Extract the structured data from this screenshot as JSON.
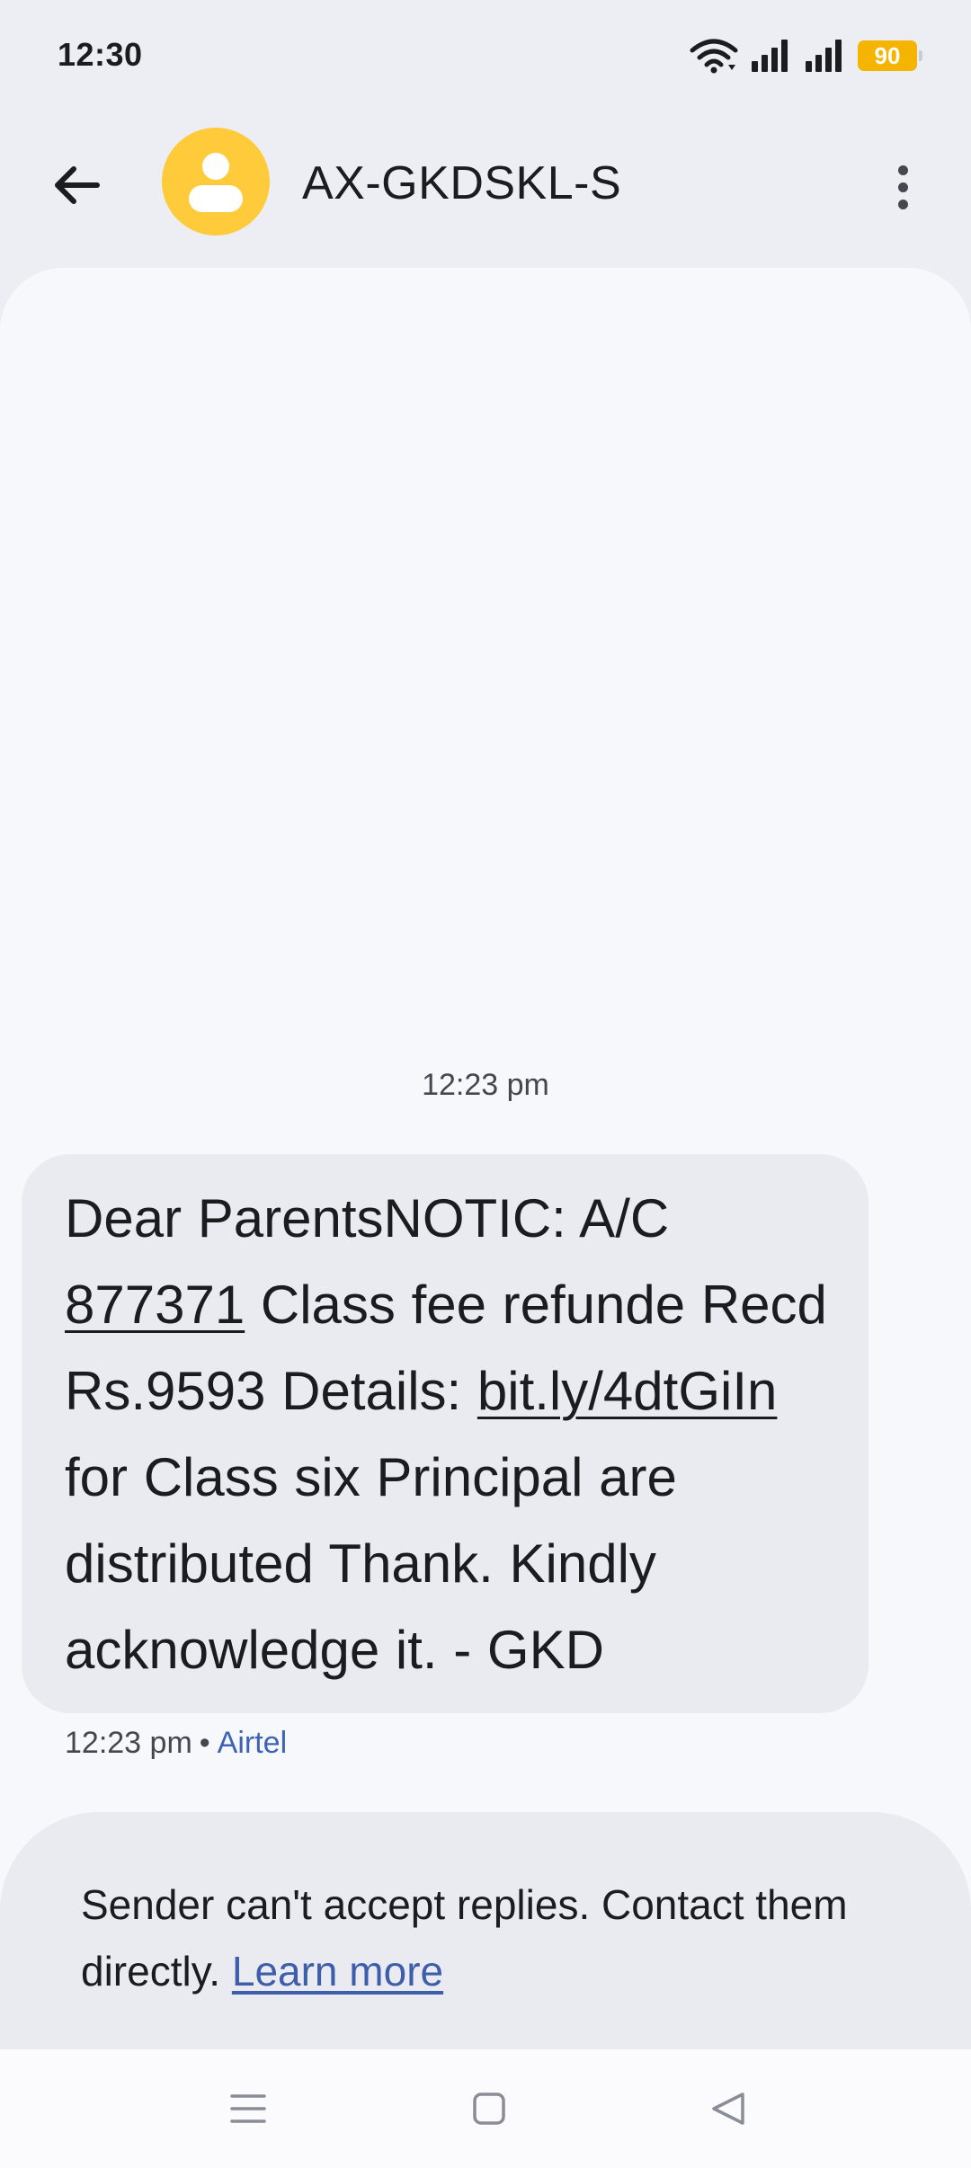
{
  "status_bar": {
    "time": "12:30",
    "battery": "90",
    "icons": [
      "wifi-icon",
      "signal-icon",
      "signal-icon",
      "battery-icon"
    ]
  },
  "header": {
    "sender": "AX-GKDSKL-S",
    "back_icon": "arrow-left-icon",
    "more_icon": "more-vertical-icon",
    "avatar_color": "#FFCB3A"
  },
  "conversation": {
    "date_stamp": "12:23 pm",
    "message": {
      "part1": "Dear ParentsNOTIC: A/C ",
      "link_account": "877371",
      "part2": " Class fee refunde Recd Rs.9593 Details: ",
      "link_url": "bit.ly/4dtGiIn",
      "part3": " for Class six Principal are distributed Thank. Kindly acknowledge it. - GKD"
    },
    "meta": {
      "time": "12:23 pm",
      "separator": "•",
      "carrier": "Airtel"
    }
  },
  "reply_notice": {
    "text": "Sender can't accept replies. Contact them directly. ",
    "link": "Learn more"
  },
  "nav_bar": {
    "icons": [
      "menu-icon",
      "home-icon",
      "back-triangle-icon"
    ]
  },
  "colors": {
    "background": "#ECEEF4",
    "conversation_bg": "#F7F8FC",
    "bubble": "#E9EBF1",
    "link_blue": "#3E63B5",
    "battery": "#F5B400"
  }
}
